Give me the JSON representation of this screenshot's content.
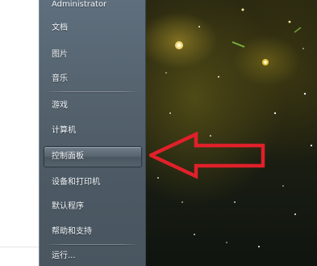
{
  "start_menu": {
    "items": [
      {
        "label": "Administrator"
      },
      {
        "label": "文档"
      },
      {
        "label": "图片"
      },
      {
        "label": "音乐"
      },
      {
        "label": "游戏"
      },
      {
        "label": "计算机"
      },
      {
        "label": "控制面板"
      },
      {
        "label": "设备和打印机"
      },
      {
        "label": "默认程序"
      },
      {
        "label": "帮助和支持"
      },
      {
        "label": "运行..."
      }
    ],
    "highlighted_item": "控制面板"
  },
  "annotation": {
    "arrow_color": "#e0202a",
    "icon": "arrow-left-outline-icon"
  },
  "colors": {
    "menu_background": "#55636f",
    "menu_text": "#f4f8fb"
  }
}
